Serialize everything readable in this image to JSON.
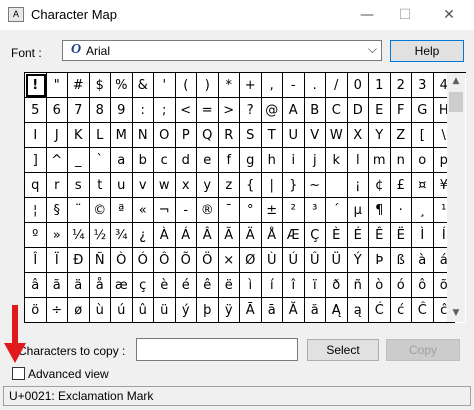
{
  "window": {
    "title": "Character Map",
    "minimize_glyph": "—",
    "maximize_glyph": "☐",
    "close_glyph": "✕"
  },
  "font": {
    "label": "Font :",
    "value": "Arial",
    "glyph": "O",
    "dropdown_glyph": "⌵"
  },
  "help_button": "Help",
  "scrollbar": {
    "up_glyph": "▲",
    "down_glyph": "▼",
    "position_fraction": 0.0
  },
  "selected_index": 0,
  "grid": [
    [
      "!",
      "\"",
      "#",
      "$",
      "%",
      "&",
      "'",
      "(",
      ")",
      "*",
      "+",
      ",",
      "-",
      ".",
      "/",
      "0",
      "1",
      "2",
      "3",
      "4"
    ],
    [
      "5",
      "6",
      "7",
      "8",
      "9",
      ":",
      ";",
      "<",
      "=",
      ">",
      "?",
      "@",
      "A",
      "B",
      "C",
      "D",
      "E",
      "F",
      "G",
      "H"
    ],
    [
      "I",
      "J",
      "K",
      "L",
      "M",
      "N",
      "O",
      "P",
      "Q",
      "R",
      "S",
      "T",
      "U",
      "V",
      "W",
      "X",
      "Y",
      "Z",
      "[",
      "\\"
    ],
    [
      "]",
      "^",
      "_",
      "`",
      "a",
      "b",
      "c",
      "d",
      "e",
      "f",
      "g",
      "h",
      "i",
      "j",
      "k",
      "l",
      "m",
      "n",
      "o",
      "p"
    ],
    [
      "q",
      "r",
      "s",
      "t",
      "u",
      "v",
      "w",
      "x",
      "y",
      "z",
      "{",
      "|",
      "}",
      "~",
      " ",
      "¡",
      "¢",
      "£",
      "¤",
      "¥"
    ],
    [
      "¦",
      "§",
      "¨",
      "©",
      "ª",
      "«",
      "¬",
      "-",
      "®",
      "¯",
      "°",
      "±",
      "²",
      "³",
      "´",
      "µ",
      "¶",
      "·",
      "¸",
      "¹"
    ],
    [
      "º",
      "»",
      "¼",
      "½",
      "¾",
      "¿",
      "À",
      "Á",
      "Â",
      "Ã",
      "Ä",
      "Å",
      "Æ",
      "Ç",
      "È",
      "É",
      "Ê",
      "Ë",
      "Ì",
      "Í"
    ],
    [
      "Î",
      "Ï",
      "Ð",
      "Ñ",
      "Ò",
      "Ó",
      "Ô",
      "Õ",
      "Ö",
      "×",
      "Ø",
      "Ù",
      "Ú",
      "Û",
      "Ü",
      "Ý",
      "Þ",
      "ß",
      "à",
      "á"
    ],
    [
      "â",
      "ã",
      "ä",
      "å",
      "æ",
      "ç",
      "è",
      "é",
      "ê",
      "ë",
      "ì",
      "í",
      "î",
      "ï",
      "ð",
      "ñ",
      "ò",
      "ó",
      "ô",
      "õ"
    ],
    [
      "ö",
      "÷",
      "ø",
      "ù",
      "ú",
      "û",
      "ü",
      "ý",
      "þ",
      "ÿ",
      "Ā",
      "ā",
      "Ă",
      "ă",
      "Ą",
      "ą",
      "Ć",
      "ć",
      "Ĉ",
      "ĉ"
    ]
  ],
  "copy": {
    "label": "Characters to copy :",
    "value": "",
    "select_button": "Select",
    "copy_button": "Copy"
  },
  "advanced_view": {
    "label": "Advanced view",
    "checked": false
  },
  "status_text": "U+0021: Exclamation Mark",
  "colors": {
    "arrow": "#e0191c",
    "help_border": "#0078d7"
  }
}
